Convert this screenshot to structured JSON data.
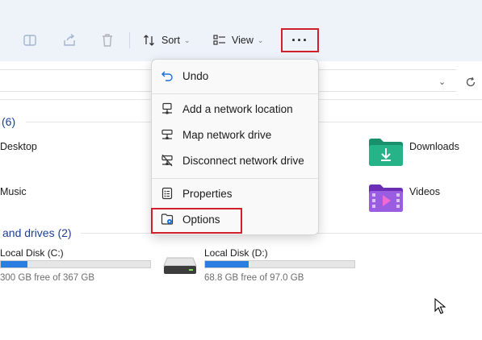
{
  "toolbar": {
    "sort_label": "Sort",
    "view_label": "View",
    "more_label": "···"
  },
  "menu": {
    "items": [
      {
        "label": "Undo",
        "icon": "undo-icon"
      },
      {
        "label": "Add a network location",
        "icon": "network-location-icon"
      },
      {
        "label": "Map network drive",
        "icon": "map-network-drive-icon"
      },
      {
        "label": "Disconnect network drive",
        "icon": "disconnect-network-drive-icon"
      },
      {
        "label": "Properties",
        "icon": "properties-icon"
      },
      {
        "label": "Options",
        "icon": "options-icon"
      }
    ]
  },
  "folders": {
    "header": "(6)",
    "items": [
      {
        "label": "Desktop"
      },
      {
        "label": "Downloads",
        "color": "#1fa37a"
      },
      {
        "label": "Music"
      },
      {
        "label": "Videos",
        "color": "#8a4bd6"
      }
    ]
  },
  "drives": {
    "header": "and drives (2)",
    "items": [
      {
        "name": "Local Disk (C:)",
        "free": "300 GB free of 367 GB",
        "used_fraction": 0.18
      },
      {
        "name": "Local Disk (D:)",
        "free": "68.8 GB free of 97.0 GB",
        "used_fraction": 0.29
      }
    ]
  },
  "colors": {
    "accent": "#2a7de1",
    "highlight_border": "#d0202b",
    "toolbar_bg": "#eef3fa",
    "section_header": "#1c3f8f"
  }
}
